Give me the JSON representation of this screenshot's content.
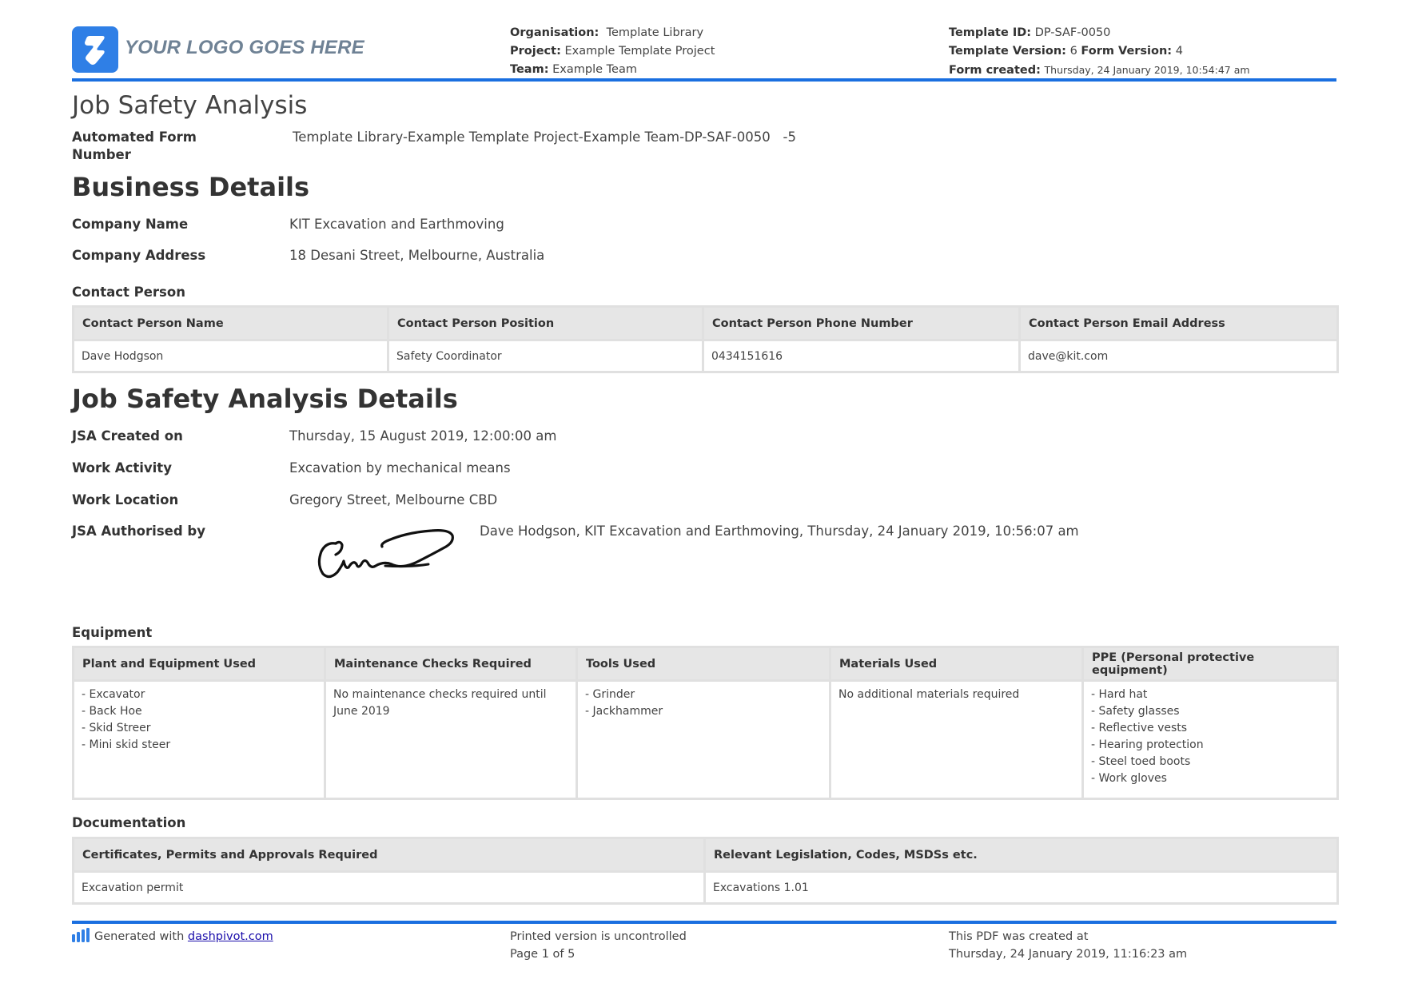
{
  "header": {
    "logo_text": "YOUR LOGO GOES HERE",
    "organisation_label": "Organisation:",
    "organisation": "Template Library",
    "project_label": "Project:",
    "project": "Example Template Project",
    "team_label": "Team:",
    "team": "Example Team",
    "template_id_label": "Template ID:",
    "template_id": "DP-SAF-0050",
    "template_version_label": "Template Version:",
    "template_version": "6",
    "form_version_label": "Form Version:",
    "form_version": "4",
    "form_created_label": "Form created:",
    "form_created": "Thursday, 24 January 2019, 10:54:47 am"
  },
  "document": {
    "title": "Job Safety Analysis",
    "form_number_label_1": "Automated Form",
    "form_number_label_2": "Number",
    "form_number": "Template Library-Example Template Project-Example Team-DP-SAF-0050   -5"
  },
  "business": {
    "heading": "Business Details",
    "company_name_label": "Company Name",
    "company_name": "KIT Excavation and Earthmoving",
    "company_address_label": "Company Address",
    "company_address": "18 Desani Street, Melbourne, Australia",
    "contact_heading": "Contact Person",
    "contact_columns": [
      "Contact Person Name",
      "Contact Person Position",
      "Contact Person Phone Number",
      "Contact Person Email Address"
    ],
    "contact_row": [
      "Dave Hodgson",
      "Safety Coordinator",
      "0434151616",
      "dave@kit.com"
    ]
  },
  "jsa": {
    "heading": "Job Safety Analysis Details",
    "created_on_label": "JSA Created on",
    "created_on": "Thursday, 15 August 2019, 12:00:00 am",
    "work_activity_label": "Work Activity",
    "work_activity": "Excavation by mechanical means",
    "work_location_label": "Work Location",
    "work_location": "Gregory Street, Melbourne CBD",
    "authorised_by_label": "JSA Authorised by",
    "authorised_by": "Dave Hodgson, KIT Excavation and Earthmoving, Thursday, 24 January 2019, 10:56:07 am"
  },
  "equipment": {
    "heading": "Equipment",
    "columns": [
      "Plant and Equipment Used",
      "Maintenance Checks Required",
      "Tools Used",
      "Materials Used",
      "PPE (Personal protective equipment)"
    ],
    "plant": [
      "- Excavator",
      "- Back Hoe",
      "- Skid Streer",
      "- Mini skid steer"
    ],
    "maintenance": "No maintenance checks required until June 2019",
    "tools": [
      "- Grinder",
      "- Jackhammer"
    ],
    "materials": "No additional materials required",
    "ppe": [
      "- Hard hat",
      "- Safety glasses",
      "- Reflective vests",
      "- Hearing protection",
      "- Steel toed boots",
      "- Work gloves"
    ]
  },
  "documentation": {
    "heading": "Documentation",
    "columns": [
      "Certificates, Permits and Approvals Required",
      "Relevant Legislation, Codes, MSDSs etc."
    ],
    "row": [
      "Excavation permit",
      "Excavations 1.01"
    ]
  },
  "footer": {
    "generated_with": "Generated with",
    "link_text": "dashpivot.com",
    "uncontrolled": "Printed version is uncontrolled",
    "page": "Page 1 of 5",
    "pdf_created_label": "This PDF was created at",
    "pdf_created": "Thursday, 24 January 2019, 11:16:23 am"
  },
  "colors": {
    "accent": "#1a6fe0",
    "logo": "#2f7fe6",
    "table_header": "#e6e6e6"
  }
}
